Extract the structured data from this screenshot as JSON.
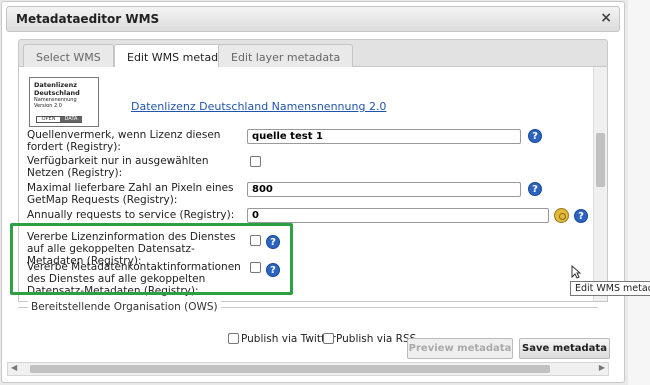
{
  "window": {
    "title": "Metadataeditor WMS",
    "close_glyph": "×"
  },
  "tabs": [
    {
      "label": "Select WMS",
      "active": false
    },
    {
      "label": "Edit WMS metadata",
      "active": true
    },
    {
      "label": "Edit layer metadata",
      "active": false
    }
  ],
  "license": {
    "logo_line1": "Datenlizenz",
    "logo_line2": "Deutschland",
    "logo_line3": "Namensnennung",
    "logo_line4": "Version 2.0",
    "badge_left": "OPEN",
    "badge_right": "DATA",
    "link_text": "Datenlizenz Deutschland Namensnennung 2.0"
  },
  "fields": [
    {
      "label": "Quellenvermerk, wenn Lizenz diesen fordert (Registry):",
      "value": "quelle test 1",
      "type": "text"
    },
    {
      "label": "Verfügbarkeit nur in ausgewählten Netzen (Registry):",
      "type": "checkbox"
    },
    {
      "label": "Maximal lieferbare Zahl an Pixeln eines GetMap Requests (Registry):",
      "value": "800",
      "type": "text"
    },
    {
      "label": "Annually requests to service (Registry):",
      "value": "0",
      "type": "text"
    },
    {
      "label": "Vererbe Lizenzinformation des Dienstes auf alle gekoppelten Datensatz-Metadaten (Registry):",
      "type": "checkbox"
    },
    {
      "label": "Vererbe Metadatenkontaktinformationen des Dienstes auf alle gekoppelten Datensatz-Metadaten (Registry):",
      "type": "checkbox"
    }
  ],
  "help_glyph": "?",
  "sections": {
    "organisation": "Bereitstellende Organisation (OWS)"
  },
  "footer": {
    "publish_twitter": "Publish via Twitter",
    "publish_rss": "Publish via RSS",
    "preview_label": "Preview metadata",
    "save_label": "Save metadata"
  },
  "scroll_arrows": {
    "left": "◀",
    "right": "▶"
  },
  "tooltip": "Edit WMS metadata",
  "icons": [
    "close-icon",
    "help-icon",
    "coin-icon",
    "cursor-icon"
  ],
  "colors": {
    "highlight": "#2da043",
    "help": "#2b64c0",
    "link": "#2255aa"
  }
}
